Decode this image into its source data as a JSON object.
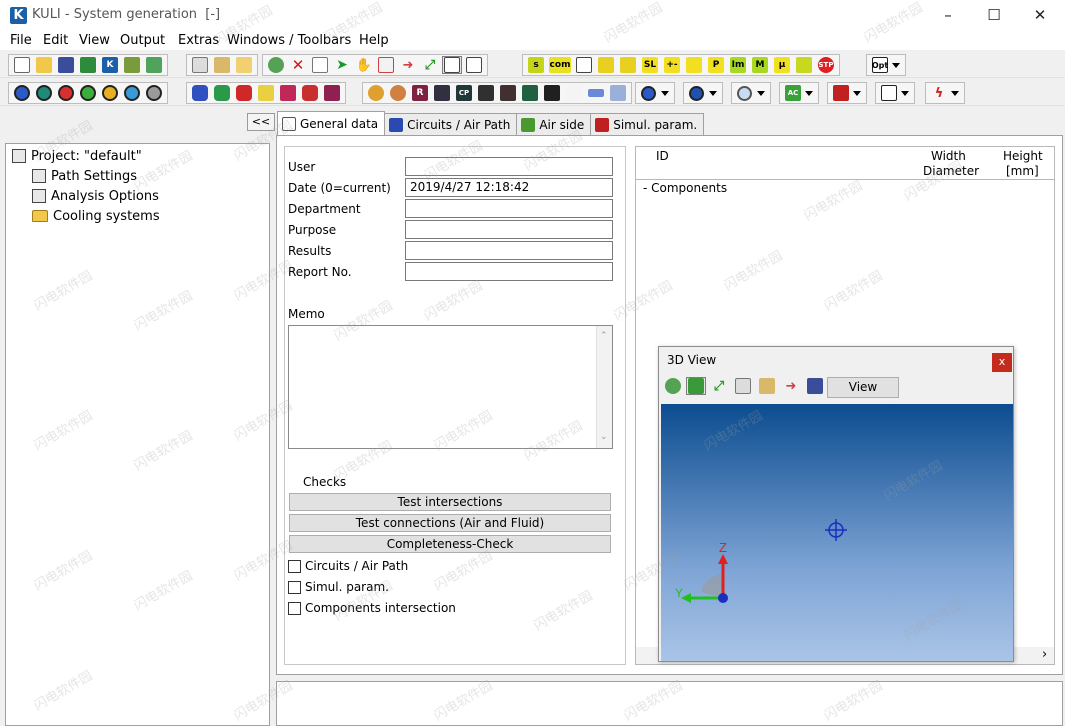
{
  "window": {
    "title": "KULI - System generation  [-]",
    "logo_letter": "K",
    "minimize": "–",
    "maximize": "☐",
    "close": "✕"
  },
  "menu": [
    "File",
    "Edit",
    "View",
    "Output",
    "Extras",
    "Windows / Toolbars",
    "Help"
  ],
  "toolbar1": {
    "labels": {
      "scom": "s",
      "com": "com",
      "sl": "SL",
      "p": "P",
      "im": "Im",
      "m": "M",
      "mu": "µ",
      "stop": "STP",
      "opt": "Opt"
    }
  },
  "toolbar2": {
    "labels": {
      "cp": "CP",
      "ac": "AC",
      "r": "R"
    }
  },
  "left_panel": {
    "collapse_label": "<<",
    "tree": {
      "root": "Project: \"default\"",
      "children": [
        "Path Settings",
        "Analysis Options",
        "Cooling systems"
      ]
    }
  },
  "tabs": [
    {
      "label": "General data",
      "active": true
    },
    {
      "label": "Circuits / Air Path",
      "active": false
    },
    {
      "label": "Air side",
      "active": false
    },
    {
      "label": "Simul. param.",
      "active": false
    }
  ],
  "general": {
    "fields": [
      {
        "label": "User",
        "value": ""
      },
      {
        "label": "Date (0=current)",
        "value": "2019/4/27 12:18:42"
      },
      {
        "label": "Department",
        "value": ""
      },
      {
        "label": "Purpose",
        "value": ""
      },
      {
        "label": "Results",
        "value": ""
      },
      {
        "label": "Report No.",
        "value": ""
      }
    ],
    "memo_label": "Memo",
    "memo_value": "",
    "checks_label": "Checks",
    "check_buttons": [
      "Test intersections",
      "Test connections (Air and Fluid)",
      "Completeness-Check"
    ],
    "checkboxes": [
      {
        "label": "Circuits / Air Path",
        "checked": false
      },
      {
        "label": "Simul. param.",
        "checked": false
      },
      {
        "label": "Components intersection",
        "checked": false
      }
    ]
  },
  "components": {
    "col_id": "ID",
    "col_width": "Width",
    "col_diameter": "Diameter",
    "col_height": "Height",
    "col_height_unit": "[mm]",
    "root_row": "-   Components",
    "scroll_right": "›"
  },
  "view3d": {
    "title": "3D View",
    "close": "x",
    "view_button": "View",
    "axis_z": "Z",
    "axis_y": "Y"
  },
  "watermark": "闪电软件园",
  "colors": {
    "accent_blue": "#1a5fa8",
    "close_red": "#c42b1c",
    "viewport_top": "#0c4c8f",
    "viewport_bottom": "#aac4e7"
  }
}
